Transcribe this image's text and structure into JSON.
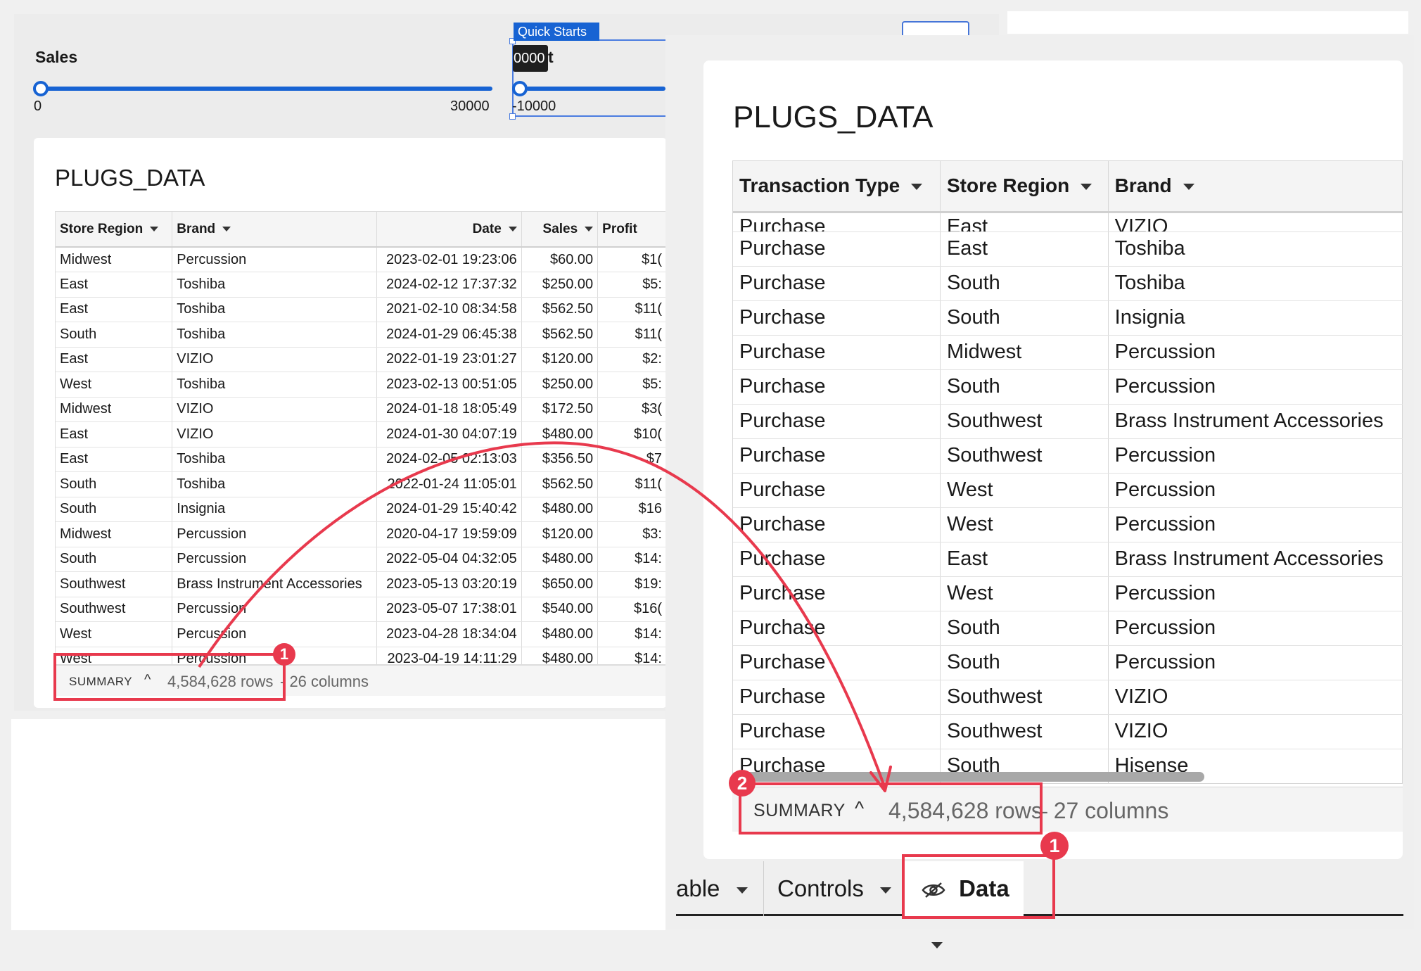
{
  "left": {
    "sales_label": "Sales",
    "sales_min": "0",
    "sales_max": "30000",
    "quick_starts": "Quick Starts",
    "profit_tooltip": "0000",
    "profit_label_tail": "t",
    "profit_min": "-10000",
    "card_title": "PLUGS_DATA",
    "columns": [
      "Store Region",
      "Brand",
      "Date",
      "Sales",
      "Profit"
    ],
    "rows": [
      [
        "Midwest",
        "Percussion",
        "2023-02-01 19:23:06",
        "$60.00",
        "$1("
      ],
      [
        "East",
        "Toshiba",
        "2024-02-12 17:37:32",
        "$250.00",
        "$5:"
      ],
      [
        "East",
        "Toshiba",
        "2021-02-10 08:34:58",
        "$562.50",
        "$11("
      ],
      [
        "South",
        "Toshiba",
        "2024-01-29 06:45:38",
        "$562.50",
        "$11("
      ],
      [
        "East",
        "VIZIO",
        "2022-01-19 23:01:27",
        "$120.00",
        "$2:"
      ],
      [
        "West",
        "Toshiba",
        "2023-02-13 00:51:05",
        "$250.00",
        "$5:"
      ],
      [
        "Midwest",
        "VIZIO",
        "2024-01-18 18:05:49",
        "$172.50",
        "$3("
      ],
      [
        "East",
        "VIZIO",
        "2024-01-30 04:07:19",
        "$480.00",
        "$10("
      ],
      [
        "East",
        "Toshiba",
        "2024-02-05 02:13:03",
        "$356.50",
        "$7"
      ],
      [
        "South",
        "Toshiba",
        "2022-01-24 11:05:01",
        "$562.50",
        "$11("
      ],
      [
        "South",
        "Insignia",
        "2024-01-29 15:40:42",
        "$480.00",
        "$16"
      ],
      [
        "Midwest",
        "Percussion",
        "2020-04-17 19:59:09",
        "$120.00",
        "$3:"
      ],
      [
        "South",
        "Percussion",
        "2022-05-04 04:32:05",
        "$480.00",
        "$14:"
      ],
      [
        "Southwest",
        "Brass Instrument Accessories",
        "2023-05-13 03:20:19",
        "$650.00",
        "$19:"
      ],
      [
        "Southwest",
        "Percussion",
        "2023-05-07 17:38:01",
        "$540.00",
        "$16("
      ],
      [
        "West",
        "Percussion",
        "2023-04-28 18:34:04",
        "$480.00",
        "$14:"
      ],
      [
        "West",
        "Percussion",
        "2023-04-19 14:11:29",
        "$480.00",
        "$14:"
      ]
    ],
    "summary_label": "SUMMARY",
    "summary_rows": "4,584,628 rows",
    "summary_cols": " - 26 columns",
    "badge": "1"
  },
  "right": {
    "card_title": "PLUGS_DATA",
    "columns": [
      "Transaction Type",
      "Store Region",
      "Brand"
    ],
    "clipped_row": [
      "Purchase",
      "East",
      "VIZIO"
    ],
    "rows": [
      [
        "Purchase",
        "East",
        "Toshiba"
      ],
      [
        "Purchase",
        "South",
        "Toshiba"
      ],
      [
        "Purchase",
        "South",
        "Insignia"
      ],
      [
        "Purchase",
        "Midwest",
        "Percussion"
      ],
      [
        "Purchase",
        "South",
        "Percussion"
      ],
      [
        "Purchase",
        "Southwest",
        "Brass Instrument Accessories"
      ],
      [
        "Purchase",
        "Southwest",
        "Percussion"
      ],
      [
        "Purchase",
        "West",
        "Percussion"
      ],
      [
        "Purchase",
        "West",
        "Percussion"
      ],
      [
        "Purchase",
        "East",
        "Brass Instrument Accessories"
      ],
      [
        "Purchase",
        "West",
        "Percussion"
      ],
      [
        "Purchase",
        "South",
        "Percussion"
      ],
      [
        "Purchase",
        "South",
        "Percussion"
      ],
      [
        "Purchase",
        "Southwest",
        "VIZIO"
      ],
      [
        "Purchase",
        "Southwest",
        "VIZIO"
      ],
      [
        "Purchase",
        "South",
        "Hisense"
      ]
    ],
    "summary_label": "SUMMARY",
    "summary_rows": "4,584,628 rows",
    "summary_cols": " – 27 columns",
    "badge_summary": "2",
    "badge_data": "1",
    "tabs": {
      "table": "able",
      "controls": "Controls",
      "data": "Data"
    }
  },
  "colors": {
    "accent_blue": "#1763d3",
    "annotation_red": "#e8394d"
  }
}
